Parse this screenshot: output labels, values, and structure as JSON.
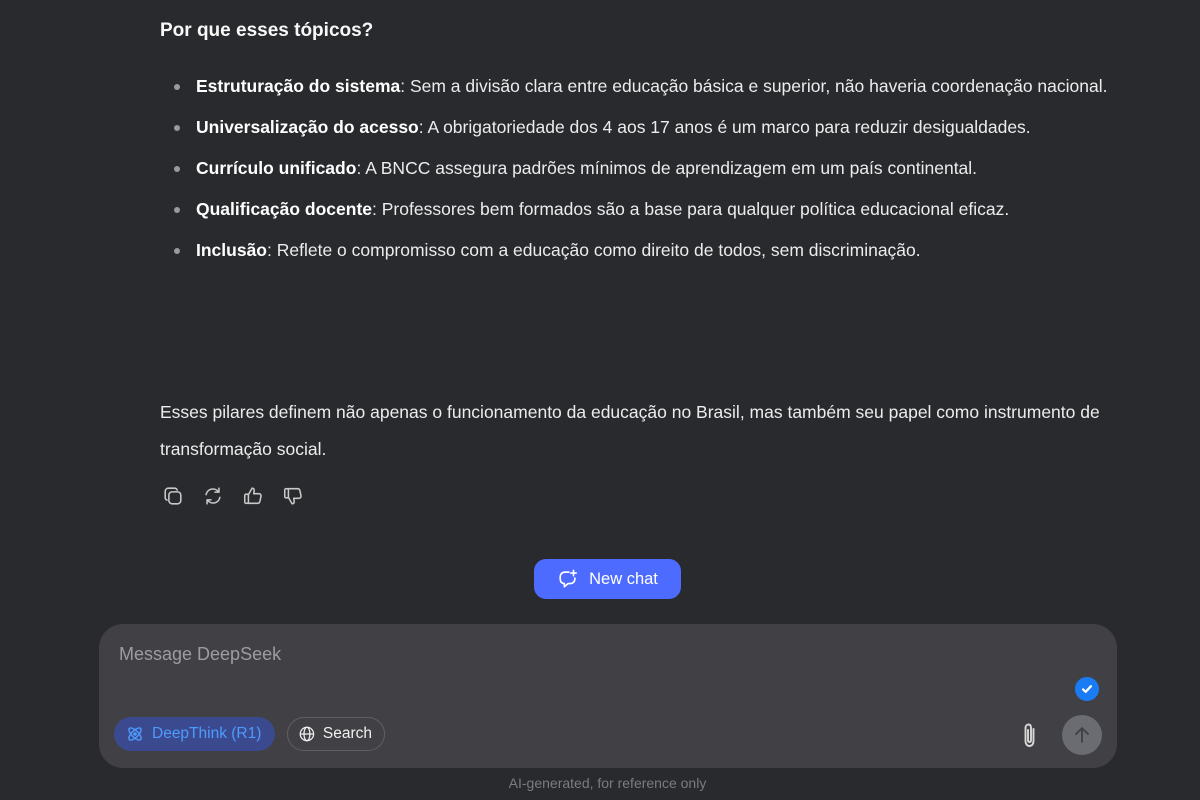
{
  "response": {
    "heading": "Por que esses tópicos?",
    "topics": [
      {
        "term": "Estruturação do sistema",
        "text": ": Sem a divisão clara entre educação básica e superior, não haveria coordenação nacional."
      },
      {
        "term": "Universalização do acesso",
        "text": ": A obrigatoriedade dos 4 aos 17 anos é um marco para reduzir desigualdades."
      },
      {
        "term": "Currículo unificado",
        "text": ": A BNCC assegura padrões mínimos de aprendizagem em um país continental."
      },
      {
        "term": "Qualificação docente",
        "text": ": Professores bem formados são a base para qualquer política educacional eficaz."
      },
      {
        "term": "Inclusão",
        "text": ": Reflete o compromisso com a educação como direito de todos, sem discriminação."
      }
    ],
    "conclusion": "Esses pilares definem não apenas o funcionamento da educação no Brasil, mas também seu papel como instrumento de transformação social.",
    "actions": [
      {
        "icon": "copy-icon",
        "label": "Copy"
      },
      {
        "icon": "regenerate-icon",
        "label": "Regenerate"
      },
      {
        "icon": "thumbs-up-icon",
        "label": "Like"
      },
      {
        "icon": "thumbs-down-icon",
        "label": "Dislike"
      }
    ]
  },
  "new_chat": {
    "label": "New chat",
    "icon": "new-chat-icon",
    "color": "#4d6bfe"
  },
  "composer": {
    "placeholder": "Message DeepSeek",
    "value": "",
    "deepthink_label": "DeepThink (R1)",
    "deepthink_active": true,
    "search_label": "Search",
    "search_active": false,
    "attach_icon": "paperclip-icon",
    "send_icon": "arrow-up-icon",
    "badge_icon": "check-icon"
  },
  "footer": {
    "disclaimer": "AI-generated, for reference only"
  }
}
